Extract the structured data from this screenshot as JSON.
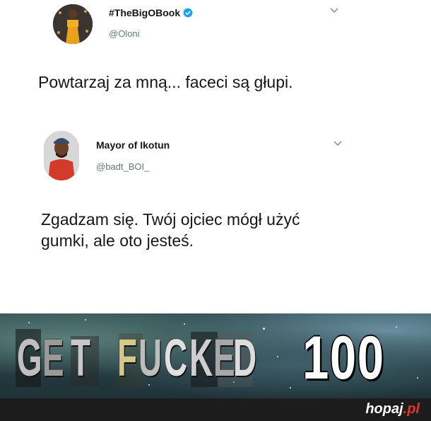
{
  "tweet1": {
    "display_name": "#TheBigOBook",
    "handle": "@Oloni",
    "text": "Powtarzaj za mną... faceci są głupi.",
    "verified": true,
    "menu_icon": "chevron-down-icon"
  },
  "tweet2": {
    "display_name": "Mayor of Ikotun",
    "handle": "@badt_BOI_",
    "text_line1": "Zgadzam się. Twój ojciec mógł użyć",
    "text_line2": "gumki, ale oto jesteś.",
    "menu_icon": "chevron-down-icon"
  },
  "meme": {
    "letters": [
      "G",
      "E",
      "T",
      "F",
      "U",
      "C",
      "K",
      "E",
      "D"
    ],
    "score": "100"
  },
  "watermark": {
    "site": "hopaj",
    "tld": ".pl"
  },
  "colors": {
    "verified_blue": "#1da1f2",
    "handle_gray": "#657786",
    "footer_bg": "#1c1c1c",
    "watermark_accent": "#e8322c"
  }
}
